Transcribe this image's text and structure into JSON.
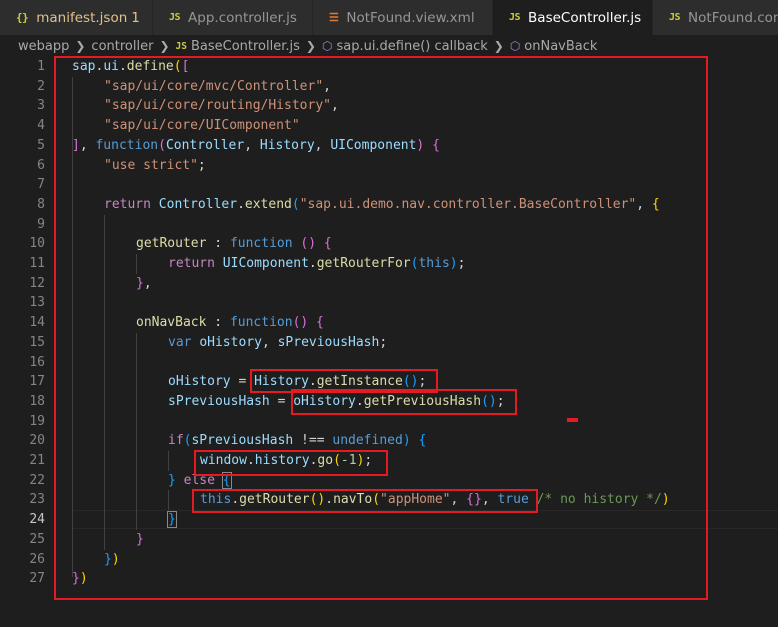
{
  "tabs": [
    {
      "icon": "{}",
      "label": "manifest.json",
      "badge": "1"
    },
    {
      "icon": "JS",
      "label": "App.controller.js"
    },
    {
      "icon": "xml",
      "label": "NotFound.view.xml"
    },
    {
      "icon": "JS",
      "label": "BaseController.js"
    },
    {
      "icon": "JS",
      "label": "NotFound.cont"
    }
  ],
  "breadcrumb": {
    "folder1": "webapp",
    "folder2": "controller",
    "file_icon": "JS",
    "file": "BaseController.js",
    "symbol1": "sap.ui.define() callback",
    "symbol2": "onNavBack"
  },
  "line_numbers": [
    "1",
    "2",
    "3",
    "4",
    "5",
    "6",
    "7",
    "8",
    "9",
    "10",
    "11",
    "12",
    "13",
    "14",
    "15",
    "16",
    "17",
    "18",
    "19",
    "20",
    "21",
    "22",
    "23",
    "24",
    "25",
    "26",
    "27"
  ],
  "code": {
    "l1": {
      "a": "sap",
      "b": ".",
      "c": "ui",
      "d": ".",
      "e": "define",
      "f": "(",
      "g": "["
    },
    "l2": {
      "a": "\"sap/ui/core/mvc/Controller\"",
      "b": ","
    },
    "l3": {
      "a": "\"sap/ui/core/routing/History\"",
      "b": ","
    },
    "l4": {
      "a": "\"sap/ui/core/UIComponent\""
    },
    "l5": {
      "a": "]",
      "b": ", ",
      "c": "function",
      "d": "(",
      "e": "Controller",
      "f": ", ",
      "g": "History",
      "h": ", ",
      "i": "UIComponent",
      "j": ")",
      "k": " ",
      "l": "{"
    },
    "l6": {
      "a": "\"use strict\"",
      "b": ";"
    },
    "l8": {
      "a": "return",
      "b": " ",
      "c": "Controller",
      "d": ".",
      "e": "extend",
      "f": "(",
      "g": "\"sap.ui.demo.nav.controller.BaseController\"",
      "h": ", ",
      "i": "{"
    },
    "l10": {
      "a": "getRouter",
      "b": " : ",
      "c": "function",
      "d": " ",
      "e": "()",
      "f": " ",
      "g": "{"
    },
    "l11": {
      "a": "return",
      "b": " ",
      "c": "UIComponent",
      "d": ".",
      "e": "getRouterFor",
      "f": "(",
      "g": "this",
      "h": ")",
      "i": ";"
    },
    "l12": {
      "a": "}",
      "b": ","
    },
    "l14": {
      "a": "onNavBack",
      "b": " : ",
      "c": "function",
      "d": "()",
      "e": " ",
      "f": "{"
    },
    "l15": {
      "a": "var",
      "b": " ",
      "c": "oHistory",
      "d": ", ",
      "e": "sPreviousHash",
      "f": ";"
    },
    "l17": {
      "a": "oHistory",
      "b": " = ",
      "c": "History",
      "d": ".",
      "e": "getInstance",
      "f": "()",
      "g": ";"
    },
    "l18": {
      "a": "sPreviousHash",
      "b": " = ",
      "c": "oHistory",
      "d": ".",
      "e": "getPreviousHash",
      "f": "()",
      "g": ";"
    },
    "l20": {
      "a": "if",
      "b": "(",
      "c": "sPreviousHash",
      "d": " !== ",
      "e": "undefined",
      "f": ")",
      "g": " ",
      "h": "{"
    },
    "l21": {
      "a": "window",
      "b": ".",
      "c": "history",
      "d": ".",
      "e": "go",
      "f": "(",
      "g": "-1",
      "h": ")",
      "i": ";"
    },
    "l22": {
      "a": "}",
      "b": " ",
      "c": "else",
      "d": " ",
      "e": "{"
    },
    "l23": {
      "a": "this",
      "b": ".",
      "c": "getRouter",
      "d": "()",
      "e": ".",
      "f": "navTo",
      "g": "(",
      "h": "\"appHome\"",
      "i": ", ",
      "j": "{}",
      "k": ", ",
      "l": "true",
      "m": " ",
      "n": "/* no history */",
      "o": ")"
    },
    "l24": {
      "a": "}"
    },
    "l25": {
      "a": "}"
    },
    "l26": {
      "a": "}",
      "b": ")"
    },
    "l27": {
      "a": "}",
      "b": ")"
    }
  },
  "colors": {
    "accent_red": "#e51b23",
    "background": "#1e1e1e"
  }
}
